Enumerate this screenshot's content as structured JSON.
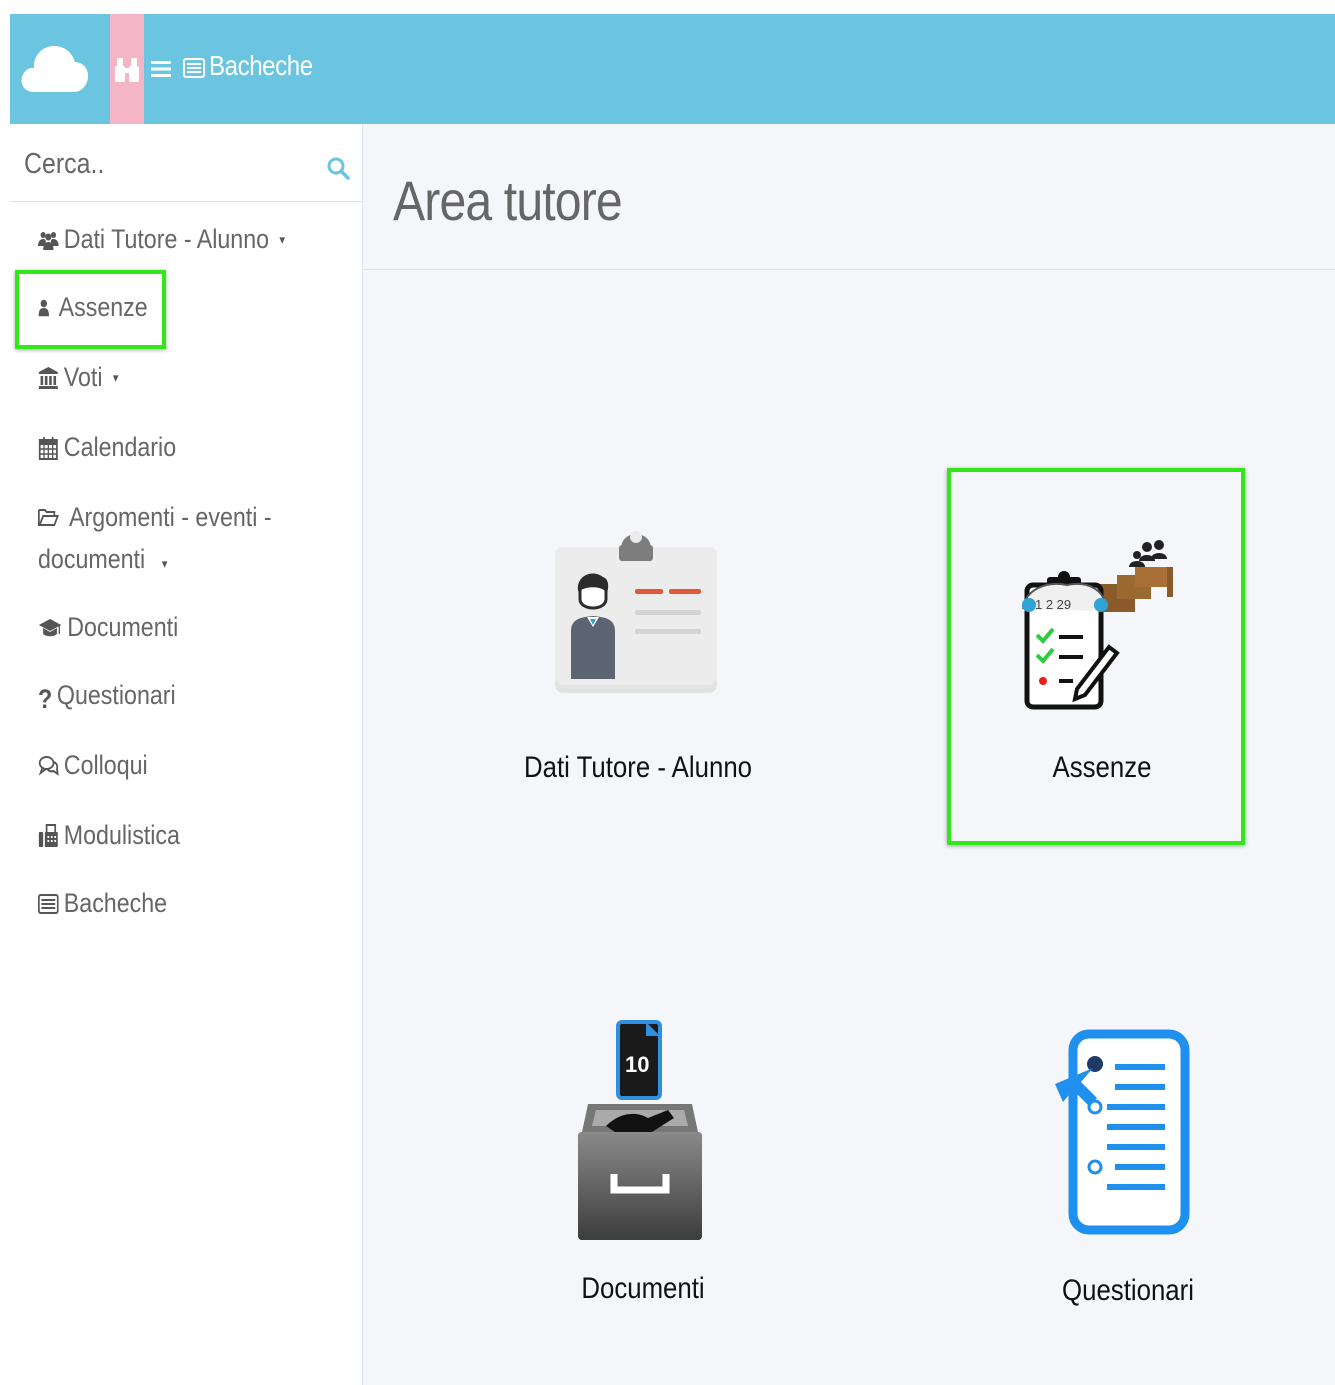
{
  "topbar": {
    "title": "Bacheche",
    "accent_color": "#6bc4e0",
    "tool_color": "#f4b6c6",
    "icons": [
      "cloud-icon",
      "binoculars-icon",
      "hamburger-icon",
      "board-icon"
    ]
  },
  "sidebar": {
    "search_placeholder": "Cerca..",
    "items": [
      {
        "label": "Dati Tutore - Alunno",
        "icon": "users-icon",
        "has_caret": true
      },
      {
        "label": "Assenze",
        "icon": "user-icon",
        "has_caret": false
      },
      {
        "label": "Voti",
        "icon": "institution-icon",
        "has_caret": true
      },
      {
        "label": "Calendario",
        "icon": "calendar-icon",
        "has_caret": false
      },
      {
        "label": "Argomenti - eventi - documenti",
        "icon": "folder-open-icon",
        "has_caret": true
      },
      {
        "label": "Documenti",
        "icon": "graduation-cap-icon",
        "has_caret": false
      },
      {
        "label": "Questionari",
        "icon": "question-icon",
        "has_caret": false
      },
      {
        "label": "Colloqui",
        "icon": "comments-icon",
        "has_caret": false
      },
      {
        "label": "Modulistica",
        "icon": "fax-icon",
        "has_caret": false
      },
      {
        "label": "Bacheche",
        "icon": "board-icon",
        "has_caret": false
      }
    ],
    "caret": "▾"
  },
  "main": {
    "title": "Area tutore",
    "tiles": [
      {
        "label": "Dati Tutore - Alunno",
        "icon": "id-badge-icon"
      },
      {
        "label": "Assenze",
        "icon": "attendance-clipboard-icon"
      },
      {
        "label": "Documenti",
        "icon": "document-drawer-icon"
      },
      {
        "label": "Questionari",
        "icon": "survey-form-icon"
      }
    ]
  },
  "highlight_color": "#33e619"
}
